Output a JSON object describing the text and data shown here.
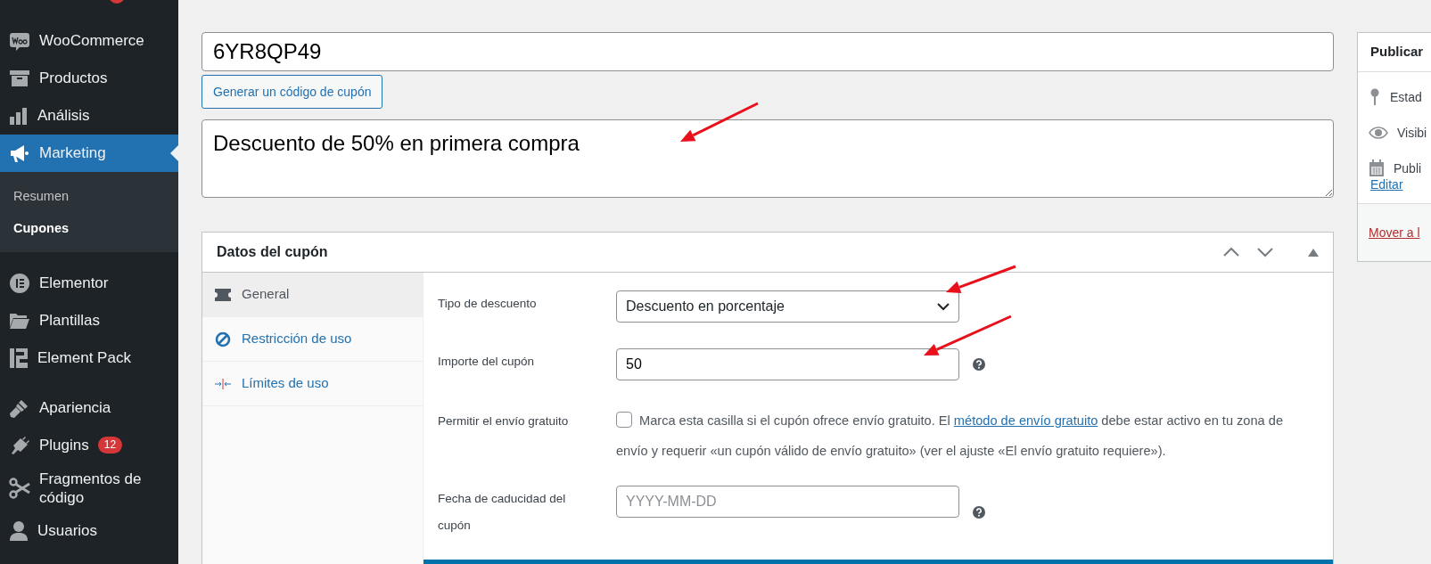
{
  "sidebar": {
    "groups": [
      {
        "items": [
          {
            "label": "WooCommerce",
            "selected": false
          },
          {
            "label": "Productos",
            "selected": false
          },
          {
            "label": "Análisis",
            "selected": false
          },
          {
            "label": "Marketing",
            "selected": true,
            "children": [
              {
                "label": "Resumen",
                "selected": false
              },
              {
                "label": "Cupones",
                "selected": true
              }
            ]
          }
        ]
      },
      {
        "items": [
          {
            "label": "Elementor",
            "selected": false
          },
          {
            "label": "Plantillas",
            "selected": false
          },
          {
            "label": "Element Pack",
            "selected": false
          }
        ]
      },
      {
        "items": [
          {
            "label": "Apariencia",
            "selected": false
          },
          {
            "label": "Plugins",
            "selected": false,
            "badge": "12"
          },
          {
            "label": "Fragmentos de código",
            "selected": false
          },
          {
            "label": "Usuarios",
            "selected": false
          }
        ]
      }
    ]
  },
  "coupon_code": {
    "value": "6YR8QP49"
  },
  "generate_button": "Generar un código de cupón",
  "description": {
    "value": "Descuento de 50% en primera compra"
  },
  "coupon_data": {
    "title": "Datos del cupón",
    "tabs": [
      {
        "label": "General",
        "selected": true
      },
      {
        "label": "Restricción de uso",
        "selected": false
      },
      {
        "label": "Límites de uso",
        "selected": false
      }
    ],
    "fields": [
      {
        "kind": "select",
        "label": "Tipo de descuento",
        "value": "Descuento en porcentaje"
      },
      {
        "kind": "number",
        "label": "Importe del cupón",
        "value": "50",
        "help": true
      },
      {
        "kind": "checkbox",
        "label": "Permitir el envío gratuito",
        "checked": false,
        "text_before": "Marca esta casilla si el cupón ofrece envío gratuito. El ",
        "link": "método de envío gratuito",
        "text_after": " debe estar activo en tu zona de envío y requerir «un cupón válido de envío gratuito» (ver el ajuste «El envío gratuito requiere»)."
      },
      {
        "kind": "date",
        "label": "Fecha de caducidad del cupón",
        "placeholder": "YYYY-MM-DD",
        "help": true
      }
    ]
  },
  "publish": {
    "title": "Publicar",
    "rows": [
      {
        "label": "Estad"
      },
      {
        "label": "Visibi"
      },
      {
        "label": "Publi"
      }
    ],
    "edit_link": "Editar",
    "trash_link": "Mover a l"
  }
}
